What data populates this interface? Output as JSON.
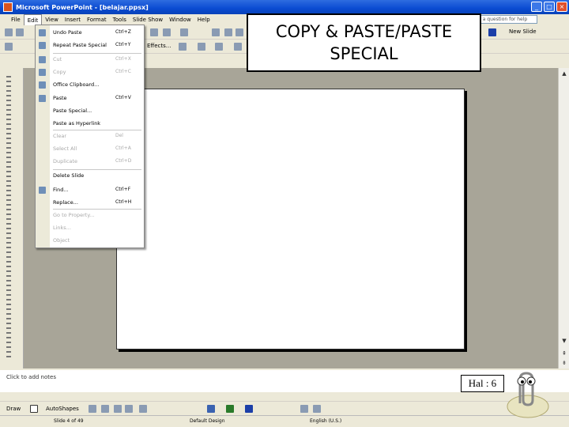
{
  "window": {
    "title": "Microsoft PowerPoint - [belajar.ppsx]",
    "minimize": "_",
    "maximize": "□",
    "close": "×"
  },
  "menubar": {
    "items": [
      "File",
      "Edit",
      "View",
      "Insert",
      "Format",
      "Tools",
      "Slide Show",
      "Window",
      "Help"
    ],
    "active_index": 1,
    "ask_placeholder": "Type a question for help"
  },
  "toolbar1": {
    "right_label": "New Slide"
  },
  "toolbar2": {
    "effects_label": "Effects..."
  },
  "edit_menu": {
    "items": [
      {
        "label": "Undo Paste",
        "shortcut": "Ctrl+Z",
        "enabled": true,
        "icon": "undo-icon"
      },
      {
        "label": "Repeat Paste Special",
        "shortcut": "Ctrl+Y",
        "enabled": true,
        "icon": "redo-icon"
      },
      {
        "label": "Cut",
        "shortcut": "Ctrl+X",
        "enabled": false,
        "icon": "cut-icon"
      },
      {
        "label": "Copy",
        "shortcut": "Ctrl+C",
        "enabled": false,
        "icon": "copy-icon"
      },
      {
        "label": "Office Clipboard...",
        "shortcut": "",
        "enabled": true,
        "icon": "clipboard-icon"
      },
      {
        "label": "Paste",
        "shortcut": "Ctrl+V",
        "enabled": true,
        "icon": "paste-icon"
      },
      {
        "label": "Paste Special...",
        "shortcut": "",
        "enabled": true,
        "icon": ""
      },
      {
        "label": "Paste as Hyperlink",
        "shortcut": "",
        "enabled": true,
        "icon": ""
      },
      {
        "label": "Clear",
        "shortcut": "Del",
        "enabled": false,
        "icon": ""
      },
      {
        "label": "Select All",
        "shortcut": "Ctrl+A",
        "enabled": false,
        "icon": ""
      },
      {
        "label": "Duplicate",
        "shortcut": "Ctrl+D",
        "enabled": false,
        "icon": ""
      },
      {
        "label": "Delete Slide",
        "shortcut": "",
        "enabled": true,
        "icon": ""
      },
      {
        "label": "Find...",
        "shortcut": "Ctrl+F",
        "enabled": true,
        "icon": "binoculars-icon"
      },
      {
        "label": "Replace...",
        "shortcut": "Ctrl+H",
        "enabled": true,
        "icon": ""
      },
      {
        "label": "Go to Property...",
        "shortcut": "",
        "enabled": false,
        "icon": ""
      },
      {
        "label": "Links...",
        "shortcut": "",
        "enabled": false,
        "icon": ""
      },
      {
        "label": "Object",
        "shortcut": "",
        "enabled": false,
        "icon": ""
      }
    ]
  },
  "overlay": {
    "line1": "COPY & PASTE/PASTE",
    "line2": "SPECIAL"
  },
  "notes": {
    "placeholder": "Click to add notes"
  },
  "page_number": "Hal : 6",
  "drawbar": {
    "draw_label": "Draw",
    "autoshapes_label": "AutoShapes"
  },
  "status": {
    "slide": "Slide 4 of 49",
    "design": "Default Design",
    "language": "English (U.S.)"
  }
}
